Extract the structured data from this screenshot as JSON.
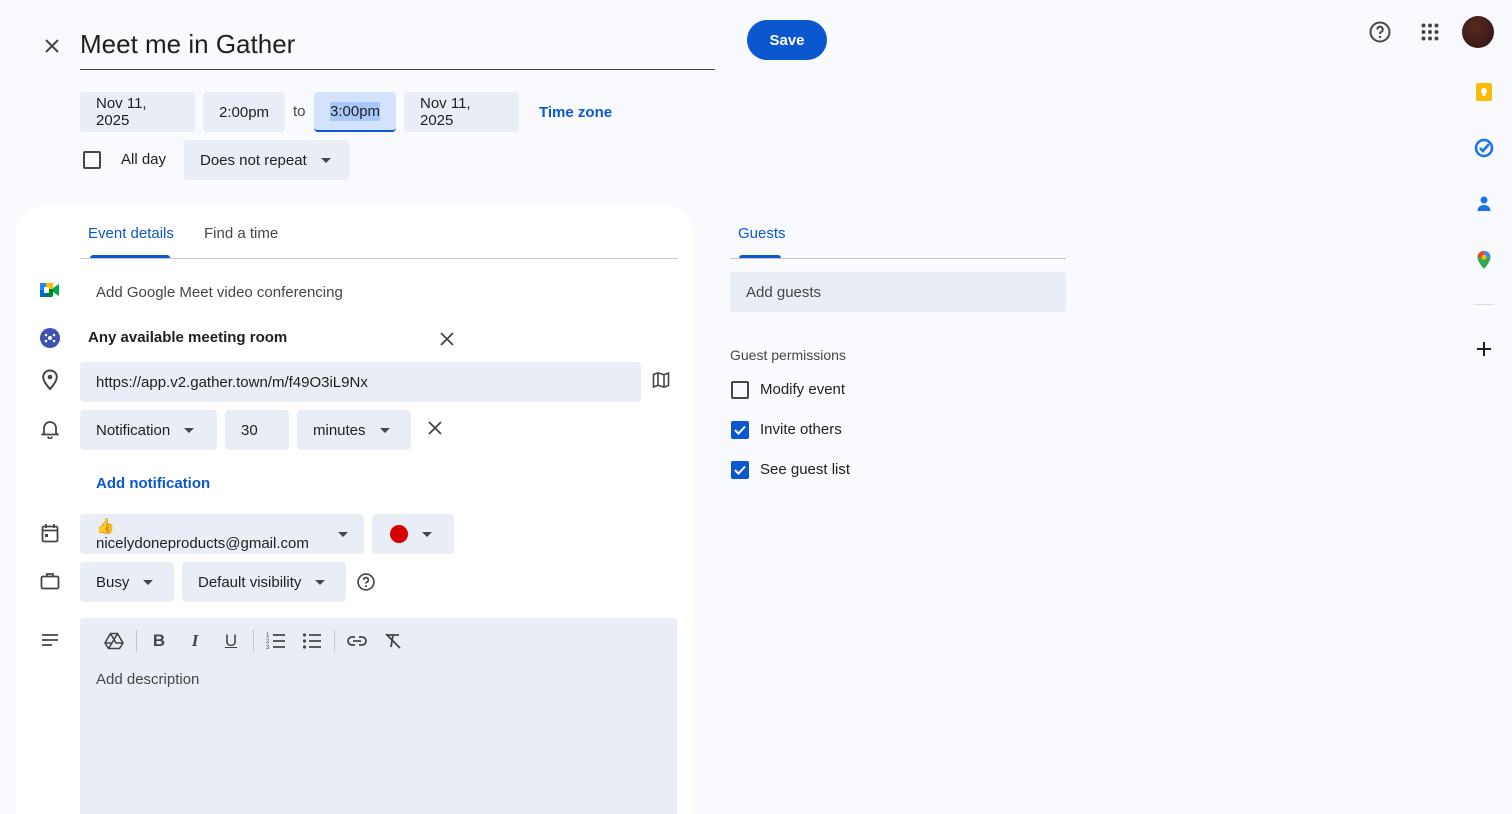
{
  "event": {
    "title": "Meet me in Gather",
    "save_label": "Save",
    "start_date": "Nov 11, 2025",
    "start_time": "2:00pm",
    "to_label": "to",
    "end_time": "3:00pm",
    "end_date": "Nov 11, 2025",
    "time_zone_label": "Time zone",
    "all_day_label": "All day",
    "all_day_checked": false,
    "repeat": "Does not repeat"
  },
  "tabs": {
    "event_details": "Event details",
    "find_a_time": "Find a time"
  },
  "details": {
    "meet_label": "Add Google Meet video conferencing",
    "room_label": "Any available meeting room",
    "location": "https://app.v2.gather.town/m/f49O3iL9Nx",
    "notification_type": "Notification",
    "notification_value": "30",
    "notification_unit": "minutes",
    "add_notification": "Add notification",
    "calendar": "👍 nicelydoneproducts@gmail.com",
    "event_color": "#d50000",
    "availability": "Busy",
    "visibility": "Default visibility",
    "description_placeholder": "Add description"
  },
  "guests": {
    "tab_label": "Guests",
    "add_placeholder": "Add guests",
    "permissions_title": "Guest permissions",
    "permissions": [
      {
        "label": "Modify event",
        "checked": false
      },
      {
        "label": "Invite others",
        "checked": true
      },
      {
        "label": "See guest list",
        "checked": true
      }
    ]
  },
  "colors": {
    "accent": "#0b57d0",
    "chip_bg": "#e9eef6",
    "page_bg": "#f8fafd"
  }
}
